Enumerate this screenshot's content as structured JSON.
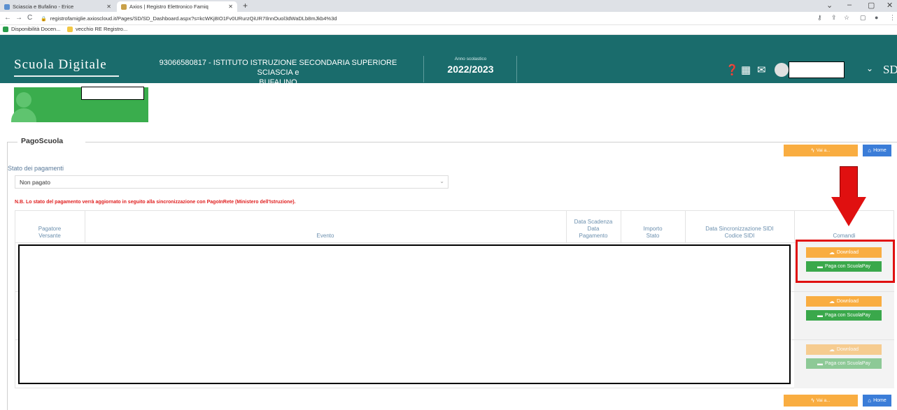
{
  "browser": {
    "tabs": [
      {
        "label": "Sciascia e Bufalino - Erice",
        "active": false
      },
      {
        "label": "Axios | Registro Elettronico Famiq",
        "active": true
      }
    ],
    "url": "registrofamiglie.axioscloud.it/Pages/SD/SD_Dashboard.aspx?s=kcWKj8IO1Fv0URurzQiUR7IlnnOuol3dWaDLb8mJkb4%3d",
    "bookmarks": [
      "Disponibilità Docen...",
      "vecchio RE Registro..."
    ]
  },
  "header": {
    "logo": "Scuola Digitale",
    "school_line1": "93066580817 - ISTITUTO ISTRUZIONE SECONDARIA SUPERIORE SCIASCIA e",
    "school_line2": "BUFALINO",
    "anno_label": "Anno scolastico",
    "anno_value": "2022/2023",
    "icons": [
      "help-icon",
      "building-icon",
      "envelope-icon",
      "avatar",
      "chevron-down-icon"
    ],
    "brand_short": "SD"
  },
  "section": {
    "title": "PagoScuola",
    "vai_label": "Vai a...",
    "home_label": "Home"
  },
  "filter": {
    "label": "Stato dei pagamenti",
    "value": "Non pagato"
  },
  "notice": "N.B. Lo stato del pagamento verrà aggiornato in seguito alla sincronizzazione con PagoInRete (Ministero dell'Istruzione).",
  "table": {
    "headers": [
      [
        "Pagatore",
        "Versante"
      ],
      [
        "Evento"
      ],
      [
        "Data Scadenza",
        "Data",
        "Pagamento"
      ],
      [
        "Importo",
        "Stato"
      ],
      [
        "Data Sincronizzazione SIDI",
        "Codice SIDI"
      ],
      [
        "Comandi"
      ]
    ],
    "rows": [
      {
        "download": "Download",
        "pay": "Paga con ScuolaPay"
      },
      {
        "download": "Download",
        "pay": "Paga con ScuolaPay"
      },
      {
        "download": "Download",
        "pay": "Paga con ScuolaPay"
      }
    ]
  },
  "colors": {
    "header_bg": "#1a6c6c",
    "orange": "#f9ad41",
    "green": "#3aa84b",
    "blue": "#3b7dd8",
    "annotation_red": "#e01010"
  }
}
